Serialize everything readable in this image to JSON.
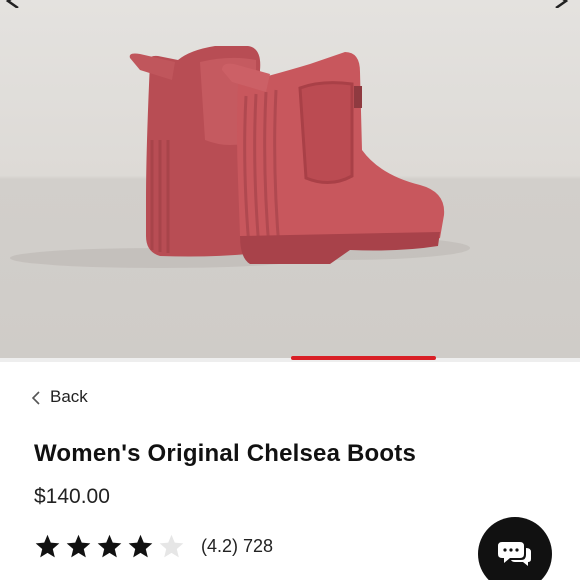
{
  "product": {
    "title": "Women's Original Chelsea Boots",
    "price": "$140.00",
    "color": "#c2545a"
  },
  "navigation": {
    "back_label": "Back",
    "back_icon": "chevron-left-icon"
  },
  "gallery": {
    "progress_color": "#d91f26"
  },
  "rating": {
    "score_text": "(4.2)",
    "review_count": "728",
    "filled_stars": 4,
    "max_stars": 5
  },
  "chat": {
    "icon": "chat-bubbles-icon",
    "background": "#111111"
  }
}
